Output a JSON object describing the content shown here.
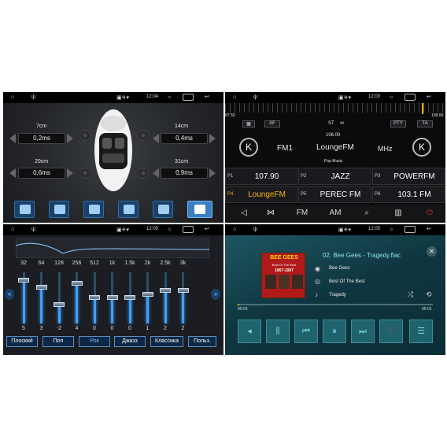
{
  "status_bars": [
    {
      "time": "12:04"
    },
    {
      "time": "12:03"
    },
    {
      "time": "12:05"
    },
    {
      "time": "12:05"
    }
  ],
  "balance": {
    "positions": [
      {
        "label": "7cm",
        "value": "0,2ms"
      },
      {
        "label": "14cm",
        "value": "0,4ms"
      },
      {
        "label": "20cm",
        "value": "0,6ms"
      },
      {
        "label": "31cm",
        "value": "0,9ms"
      }
    ],
    "preset_count": 6
  },
  "radio": {
    "range_min": "87.50",
    "range_max": "108.00",
    "buttons": {
      "af": "AF",
      "st": "ST",
      "pty": "PTY",
      "ta": "TA"
    },
    "band": "FM1",
    "station": "LoungeFM",
    "unit": "MHz",
    "frequency": "106.00",
    "genre": "Pop Music",
    "presets": [
      {
        "num": "P1",
        "name": "107.90"
      },
      {
        "num": "P2",
        "name": "JAZZ"
      },
      {
        "num": "P3",
        "name": "POWERFM"
      },
      {
        "num": "P4",
        "name": "LoungeFM"
      },
      {
        "num": "P5",
        "name": "PEREC FM"
      },
      {
        "num": "P6",
        "name": "103.1 FM"
      }
    ],
    "toolbar": {
      "fm": "FM",
      "am": "AM"
    }
  },
  "equalizer": {
    "bands": [
      "32",
      "64",
      "128",
      "256",
      "512",
      "1k",
      "1.5k",
      "2k",
      "2.5k",
      "3k"
    ],
    "values": [
      "5",
      "3",
      "-2",
      "4",
      "0",
      "0",
      "0",
      "1",
      "2",
      "2"
    ],
    "presets": [
      "Плоский",
      "Поп",
      "Рок",
      "Джазз",
      "Классика",
      "Польз."
    ]
  },
  "player": {
    "title": "02. Bee Gees - Tragedy.flac",
    "artist": "Bee Gees",
    "album": "Best Of The Best",
    "song": "Tragedy",
    "time_elapsed": "00:03",
    "time_total": "05:01",
    "progress": 0.01,
    "cover_band": "BEE GEES",
    "cover_title": "Best Of The Best",
    "cover_years": "1967-1997"
  }
}
